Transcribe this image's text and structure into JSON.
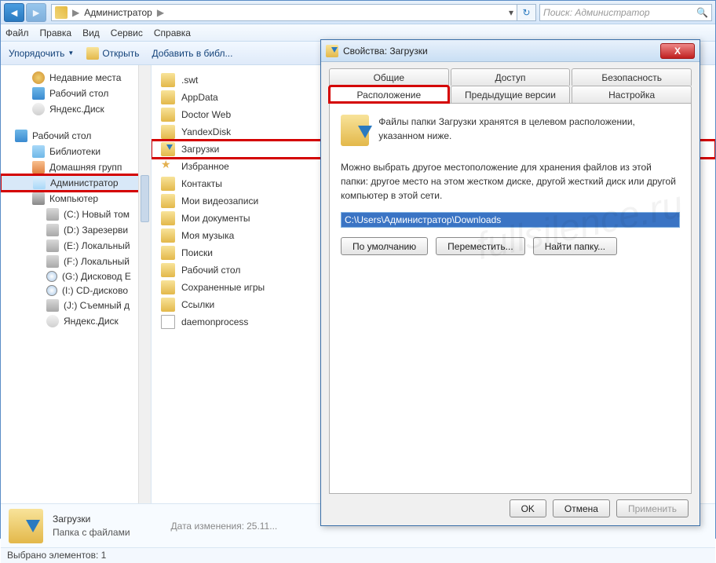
{
  "titlebar": {
    "breadcrumb_root": "Администратор",
    "search_placeholder": "Поиск: Администратор"
  },
  "menu": {
    "file": "Файл",
    "edit": "Правка",
    "view": "Вид",
    "tools": "Сервис",
    "help": "Справка"
  },
  "toolbar": {
    "organize": "Упорядочить",
    "open": "Открыть",
    "add_to_library": "Добавить в библ..."
  },
  "tree": {
    "recent": "Недавние места",
    "desktop1": "Рабочий стол",
    "yadisk1": "Яндекс.Диск",
    "desktop2": "Рабочий стол",
    "libraries": "Библиотеки",
    "homegroup": "Домашняя групп",
    "admin": "Администратор",
    "computer": "Компьютер",
    "drives": [
      "(C:) Новый том",
      "(D:) Зарезерви",
      "(E:) Локальный",
      "(F:) Локальный",
      "(G:) Дисковод E",
      "(I:) CD-дисково",
      "(J:) Съемный д",
      "Яндекс.Диск"
    ]
  },
  "content": {
    "items": [
      {
        "icon": "folder",
        "label": ".swt"
      },
      {
        "icon": "folder",
        "label": "AppData"
      },
      {
        "icon": "folder",
        "label": "Doctor Web"
      },
      {
        "icon": "folder",
        "label": "YandexDisk"
      },
      {
        "icon": "dl",
        "label": "Загрузки",
        "boxed": true
      },
      {
        "icon": "fav",
        "label": "Избранное"
      },
      {
        "icon": "folder",
        "label": "Контакты"
      },
      {
        "icon": "folder",
        "label": "Мои видеозаписи"
      },
      {
        "icon": "folder",
        "label": "Мои документы"
      },
      {
        "icon": "folder",
        "label": "Моя музыка"
      },
      {
        "icon": "folder",
        "label": "Поиски"
      },
      {
        "icon": "folder",
        "label": "Рабочий стол"
      },
      {
        "icon": "folder",
        "label": "Сохраненные игры"
      },
      {
        "icon": "link",
        "label": "Ссылки"
      },
      {
        "icon": "file",
        "label": "daemonprocess"
      }
    ]
  },
  "detail": {
    "name": "Загрузки",
    "type": "Папка с файлами",
    "meta_label": "Дата изменения:",
    "meta_value": "25.11..."
  },
  "status": {
    "selected": "Выбрано элементов: 1"
  },
  "dialog": {
    "title": "Свойства: Загрузки",
    "tabs_row1": [
      "Общие",
      "Доступ",
      "Безопасность"
    ],
    "tabs_row2": [
      "Расположение",
      "Предыдущие версии",
      "Настройка"
    ],
    "desc": "Файлы папки Загрузки хранятся в целевом расположении, указанном ниже.",
    "desc2": "Можно выбрать другое местоположение для хранения файлов из этой папки: другое место на этом жестком диске, другой жесткий диск или другой компьютер в этой сети.",
    "path": "C:\\Users\\Администратор\\Downloads",
    "btn_default": "По умолчанию",
    "btn_move": "Переместить...",
    "btn_find": "Найти папку...",
    "btn_ok": "OK",
    "btn_cancel": "Отмена",
    "btn_apply": "Применить"
  }
}
